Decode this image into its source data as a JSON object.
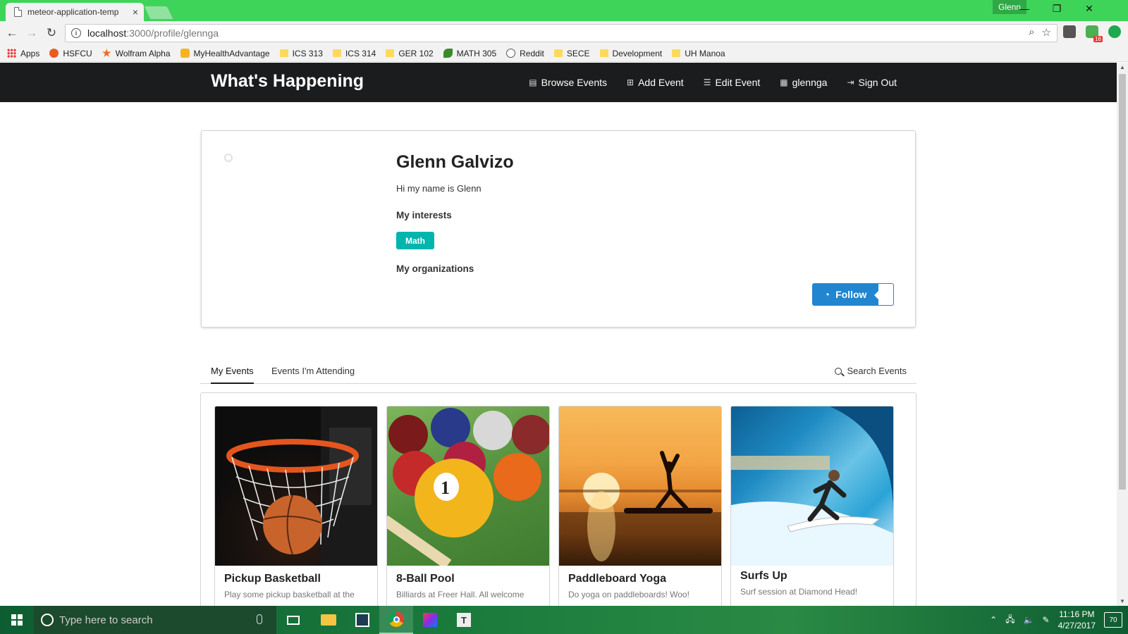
{
  "browser": {
    "tab_title": "meteor-application-temp",
    "tab_close": "×",
    "profile_name": "Glenn",
    "url_host": "localhost",
    "url_path": ":3000/profile/glennga",
    "bookmarks": [
      "Apps",
      "HSFCU",
      "Wolfram Alpha",
      "MyHealthAdvantage",
      "ICS 313",
      "ICS 314",
      "GER 102",
      "MATH 305",
      "Reddit",
      "SECE",
      "Development",
      "UH Manoa"
    ],
    "extension_badge": "16"
  },
  "site": {
    "brand": "What's Happening",
    "nav": {
      "browse": "Browse Events",
      "add": "Add Event",
      "edit": "Edit Event",
      "user": "glennga",
      "signout": "Sign Out"
    }
  },
  "profile": {
    "name": "Glenn Galvizo",
    "bio": "Hi my name is Glenn",
    "interests_heading": "My interests",
    "interests": [
      "Math"
    ],
    "organizations_heading": "My organizations",
    "follow_label": "Follow"
  },
  "tabs": {
    "my_events": "My Events",
    "attending": "Events I'm Attending",
    "search": "Search Events"
  },
  "events": [
    {
      "title": "Pickup Basketball",
      "desc": "Play some pickup basketball at the"
    },
    {
      "title": "8-Ball Pool",
      "desc": "Billiards at Freer Hall. All welcome"
    },
    {
      "title": "Paddleboard Yoga",
      "desc": "Do yoga on paddleboards! Woo!"
    },
    {
      "title": "Surfs Up",
      "desc": "Surf session at Diamond Head!"
    }
  ],
  "taskbar": {
    "search_placeholder": "Type here to search",
    "time": "11:16 PM",
    "date": "4/27/2017",
    "notification_count": "70"
  },
  "colors": {
    "titlebar": "#3ed45a",
    "navbar": "#1b1c1d",
    "teal": "#00b5ad",
    "blue": "#2185d0"
  }
}
